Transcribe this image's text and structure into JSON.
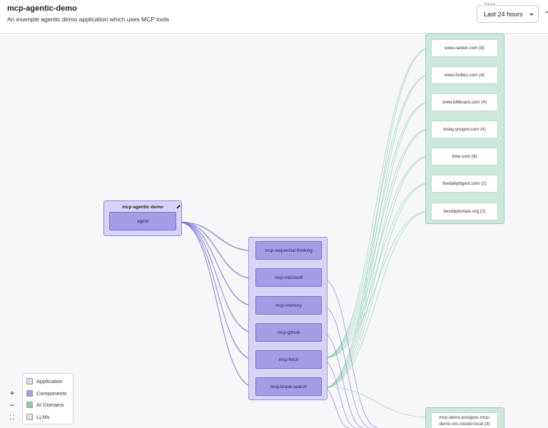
{
  "header": {
    "title": "mcp-agentic-demo",
    "subtitle": "An example agentic demo application which uses MCP tools",
    "since": {
      "label": "Since",
      "value": "Last 24 hours"
    }
  },
  "application": {
    "title": "mcp-agentic-demo",
    "agent_label": "agent"
  },
  "components": [
    "mcp-sequential-thinking",
    "mcp-microsoft",
    "mcp-memory",
    "mcp-github",
    "mcp-fetch",
    "mcp-brave-search"
  ],
  "ai_domains": [
    "www.ranker.com (8)",
    "www.forbes.com (4)",
    "www.billboard.com (4)",
    "today.yougov.com (4)",
    "time.com (6)",
    "thedailydigest.com (2)",
    "bestdiplomats.org (2)"
  ],
  "llms": [
    "mcp-demo-postgres.mcp-demo.svc.cluster.local (3)"
  ],
  "zoom": {
    "in": "+",
    "out": "−",
    "fit": "⛶"
  },
  "legend": [
    {
      "label": "Application",
      "color": "#dcd9f5"
    },
    {
      "label": "Components",
      "color": "#a39de6"
    },
    {
      "label": "AI Domains",
      "color": "#86cfa4"
    },
    {
      "label": "LLMs",
      "color": "#d4ece2"
    }
  ],
  "colors": {
    "component_edge": "#7f77d6",
    "domain_edge": "#8fcfb4",
    "domain_arrow": "#6cc29b"
  }
}
